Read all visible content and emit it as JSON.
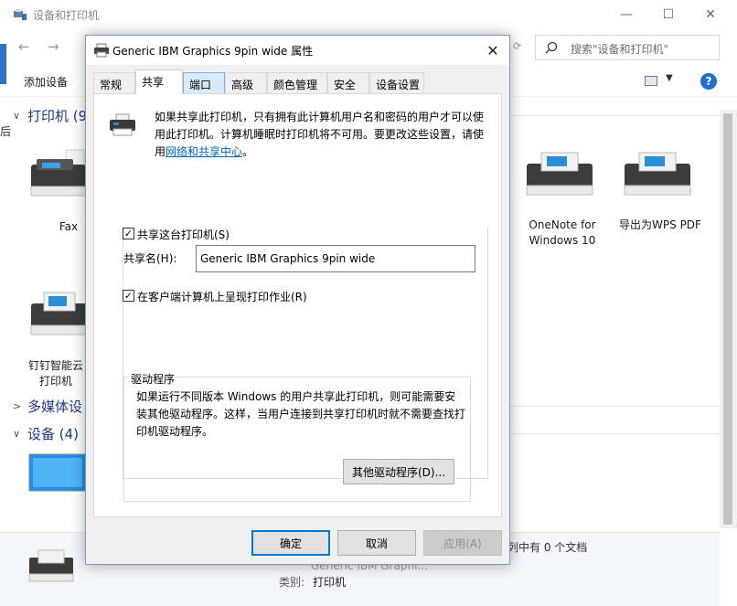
{
  "explorer": {
    "title": "设备和打印机",
    "search_placeholder": "搜索\"设备和打印机\"",
    "toolbar": {
      "add_device": "添加设备"
    },
    "left_fragment": "后",
    "groups": {
      "printers": "打印机 (9",
      "multimedia": "多媒体设",
      "devices": "设备 (4)"
    },
    "devices": {
      "fax": "Fax",
      "onenote": "OneNote for Windows 10",
      "wps": "导出为WPS PDF",
      "dingtalk": "钉钉智能云打印机"
    },
    "details": {
      "queue_text": "列中有 0 个文档",
      "model_fade": "Generic IBM Graphi...",
      "category_label": "类别:",
      "category_value": "打印机"
    },
    "icons": [
      "printer-icon",
      "search-icon",
      "help-icon",
      "monitor-icon",
      "fax-icon"
    ]
  },
  "dialog": {
    "title": "Generic IBM Graphics 9pin wide 属性",
    "tabs": [
      "常规",
      "共享",
      "端口",
      "高级",
      "颜色管理",
      "安全",
      "设备设置"
    ],
    "active_tab": "共享",
    "info_text": "如果共享此打印机，只有拥有此计算机用户名和密码的用户才可以使用此打印机。计算机睡眠时打印机将不可用。要更改这些设置，请使用",
    "info_link": "网络和共享中心",
    "info_end": "。",
    "share_checkbox_label": "共享这台打印机(S)",
    "share_checked": true,
    "share_name_label": "共享名(H):",
    "share_name_value": "Generic IBM Graphics 9pin wide",
    "render_jobs_label": "在客户端计算机上呈现打印作业(R)",
    "render_jobs_checked": true,
    "driver_group_label": "驱动程序",
    "driver_text": "如果运行不同版本 Windows 的用户共享此打印机，则可能需要安装其他驱动程序。这样，当用户连接到共享打印机时就不需要查找打印机驱动程序。",
    "driver_button": "其他驱动程序(D)...",
    "buttons": {
      "ok": "确定",
      "cancel": "取消",
      "apply": "应用(A)"
    }
  }
}
